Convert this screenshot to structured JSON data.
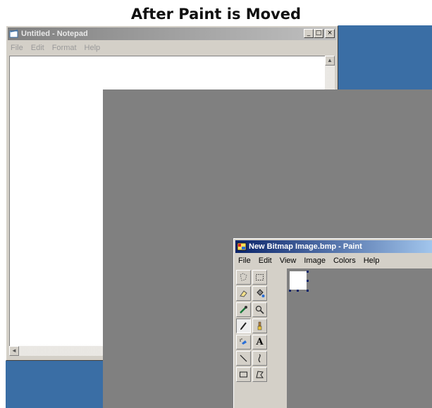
{
  "caption": "After Paint is Moved",
  "notepad": {
    "title": "Untitled - Notepad",
    "menu": [
      "File",
      "Edit",
      "Format",
      "Help"
    ],
    "buttons": {
      "minimize": "_",
      "maximize": "□",
      "close": "×"
    }
  },
  "paint": {
    "title": "New Bitmap Image.bmp - Paint",
    "menu": [
      "File",
      "Edit",
      "View",
      "Image",
      "Colors",
      "Help"
    ],
    "tools": [
      "free-select-icon",
      "rect-select-icon",
      "eraser-icon",
      "fill-icon",
      "eyedropper-icon",
      "magnifier-icon",
      "pencil-icon",
      "brush-icon",
      "airbrush-icon",
      "text-icon",
      "line-icon",
      "curve-icon",
      "rectangle-icon",
      "polygon-icon"
    ],
    "text_tool_label": "A"
  },
  "colors": {
    "desktop": "#3a6ea5",
    "window_face": "#d4d0c8",
    "active_title": "#0a246a",
    "inactive_title": "#808080",
    "moved_area": "#808080"
  }
}
